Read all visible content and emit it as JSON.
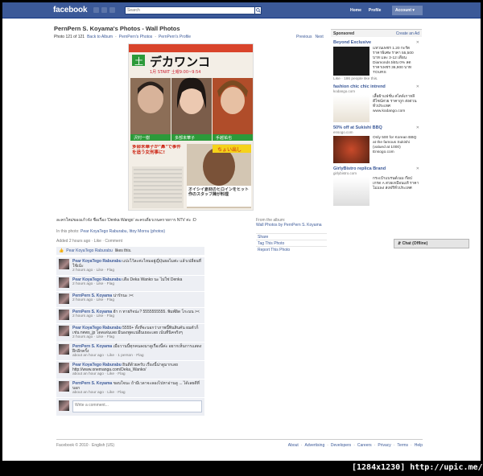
{
  "header": {
    "logo": "facebook",
    "search_placeholder": "Search",
    "nav": [
      "Home",
      "Profile",
      "Account ▾"
    ]
  },
  "page": {
    "title": "PernPern S. Koyama's Photos - Wall Photos",
    "photo_count": "Photo 121 of 121",
    "back_album": "Back to Album",
    "sep1": "·",
    "pern_photos": "PernPern's Photos",
    "sep2": "·",
    "pern_profile": "PernPern's Profile",
    "previous": "Previous",
    "next": "Next"
  },
  "photo": {
    "big_title": "デカワンコ",
    "badge": "土",
    "date_line": "1月 START 土曜9:00~9:54",
    "names": [
      "沢村一樹",
      "多部未華子",
      "手越祐也"
    ],
    "headline": "多部未華子が\"鼻\"で事件を追う女刑事に!",
    "side_text": "オイシイ素材のヒロインをヒット作のスタッフ陣が料理",
    "small_text": "ちょい出し"
  },
  "caption": {
    "text": "ละครใหม่ของแก้วจัง ชื่อเรื่อง 'Denka Wango' ละครเดี่ยวเรนครายการ NTV ค่ะ :D",
    "in_photo_prefix": "In this photo:",
    "tagged": "Pear KoyaTego Raburabu, Ittoy Morou (photos)",
    "added": "Added 2 hours ago · Like · Comment"
  },
  "album": {
    "from": "From the album:",
    "album_name": "Wall Photos by PernPern S. Koyama",
    "links": [
      "Share",
      "Tag This Photo",
      "Report This Photo"
    ]
  },
  "likes": {
    "name": "Pear KoyaTego Raburabu",
    "suffix": "likes this."
  },
  "comments": [
    {
      "name": "Pear KoyaTego Raburabu",
      "text": "แปะไว้ละค่ะไหมอยู่ญี่ปุ่นยอไมต่ะ แล้วเปลี่ยนที่ใช้เน้ะ",
      "meta": "2 hours ago · Like · Flag"
    },
    {
      "name": "Pear KoyaTego Raburabu",
      "text": "เดือ Deka Wanko นะ ไม่ใช่ Denka",
      "meta": "2 hours ago · Like · Flag"
    },
    {
      "name": "PernPern S. Koyama",
      "text": "น่ารักนะ ><",
      "meta": "2 hours ago · Like · Flag"
    },
    {
      "name": "PernPern S. Koyama",
      "text": "ฮ้า ก ทายกิจน่ะ? 5555555555. พิมพ์ผิด โกะมน ><",
      "meta": "2 hours ago · Like · Flag"
    },
    {
      "name": "Pear KoyaTego Raburabu",
      "text": "5555+ ทั้งที่จะบอกว่าภาพนี้พินสินคัน ผมตัวก็เช่น news_jp โดดเด่นเลย มีนองพูดแน่อื่นเยอะเลย เน้นที่นิคจริงๆ",
      "meta": "2 hours ago · Like · Flag"
    },
    {
      "name": "PernPern S. Koyama",
      "text": "เมื่อวานนี้ทุกคนลงมาดูเรื่องนี้ค่ะ อยากเห็นการแสดงฝึกอีกครั้ง",
      "meta": "about an hour ago · Like · 1 person · Flag"
    },
    {
      "name": "Pear KoyaTego Raburabu",
      "text": "ยินดีด้วยครับ เรื่องนี้น่าดูมากเลย http://www.onemanga.com/Deka_Wanko/",
      "meta": "about an hour ago · Like · Flag"
    },
    {
      "name": "PernPern S. Koyama",
      "text": "ขอบใจนะ ถ้ามีเวลาจะลองไปหาอ่านดู ... ได้เลยดีที่บอก",
      "meta": "about an hour ago · Like · Flag"
    }
  ],
  "write_comment": "Write a comment...",
  "sidebar": {
    "sponsored": "Sponsored",
    "create_ad": "Create an Ad",
    "ads": [
      {
        "title": "Beyond Exclusive",
        "url": "",
        "text": "แหวนเพชร 1.20 กะรัต ราคาพิเศษ ราคา 55,500 บาท และ 3-12 เดือน Diamonds ผ่อน 0% ลด ราคาเพชร 36,900 บาท TOURS",
        "like": "Like · 186 people like this."
      },
      {
        "title": "fashion chic chic intrend",
        "url": "kodango.com",
        "text": "เสื้อผ้าแฟชั่น สไตล์เกาหลี ดีไซน์สวย ราคาถูก ส่งด่วนทั่วประเทศ www.kodango.com",
        "like": ""
      },
      {
        "title": "50% off at Sukishi BBQ",
        "url": "ensogo.com",
        "text": "Only 500 for Korean BBQ at the famous Sukishi (valued at 1000) Ensogo.com",
        "like": ""
      },
      {
        "title": "GirlyBistro replica Brand",
        "url": "girlybistro.com",
        "text": "กระเป๋าแบรนด์เนม ก๊อปเกรด A สวยเหมือนแท้ ราคาไม่แพง ส่งฟรีทั่วประเทศ",
        "like": ""
      }
    ]
  },
  "chat": "Chat (Offline)",
  "footer": {
    "left": "Facebook © 2010 · English (US)",
    "links": [
      "About",
      "·",
      "Advertising",
      "·",
      "Developers",
      "·",
      "Careers",
      "·",
      "Privacy",
      "·",
      "Terms",
      "·",
      "Help"
    ]
  },
  "watermark": "[1284x1230] http://upic.me/"
}
